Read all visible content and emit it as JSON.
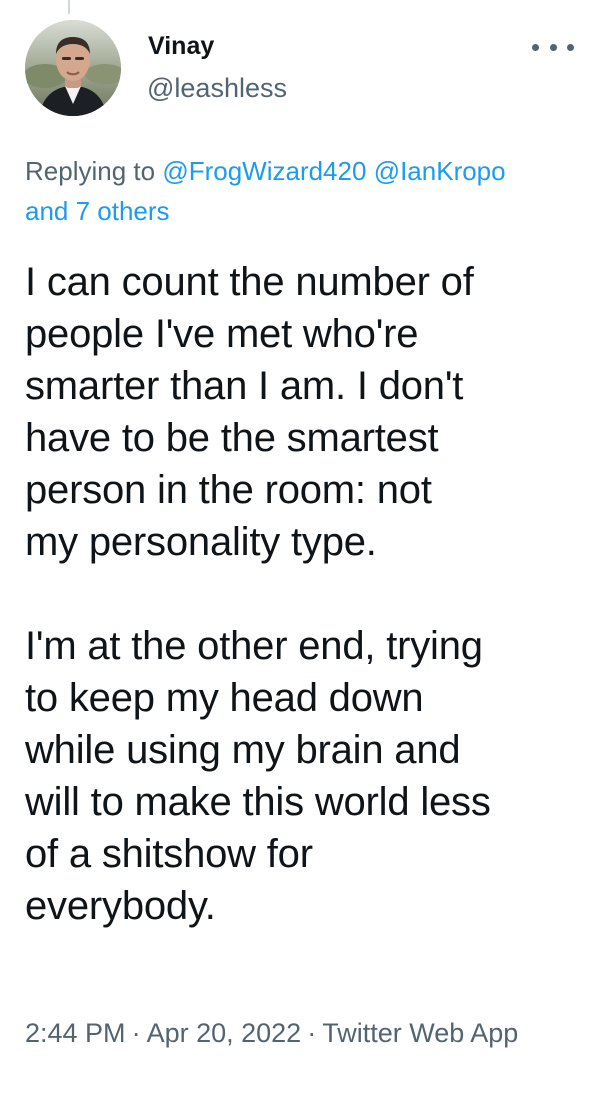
{
  "author": {
    "display_name": "Vinay",
    "handle": "@leashless",
    "avatar_icon": "user-avatar-photo"
  },
  "menu": {
    "icon": "more-horizontal-icon"
  },
  "reply_context": {
    "prefix": "Replying to",
    "mention_1": "@FrogWizard420",
    "mention_2": "@IanKropo",
    "others": "and 7 others"
  },
  "tweet": {
    "lines_p1": [
      "I can count the number of",
      "people I've met who're",
      "smarter than I am. I don't",
      "have to be the smartest",
      "person in the room: not",
      "my personality type."
    ],
    "lines_p2": [
      "I'm at the other end, trying",
      "to keep my head down",
      "while using my brain and",
      "will to make this world less",
      "of a shitshow for",
      "everybody."
    ]
  },
  "meta": {
    "time": "2:44 PM",
    "separator": "·",
    "date": "Apr 20, 2022",
    "source": "Twitter Web App"
  },
  "colors": {
    "text": "#0f1419",
    "secondary": "#536471",
    "link": "#1d9bf0"
  }
}
